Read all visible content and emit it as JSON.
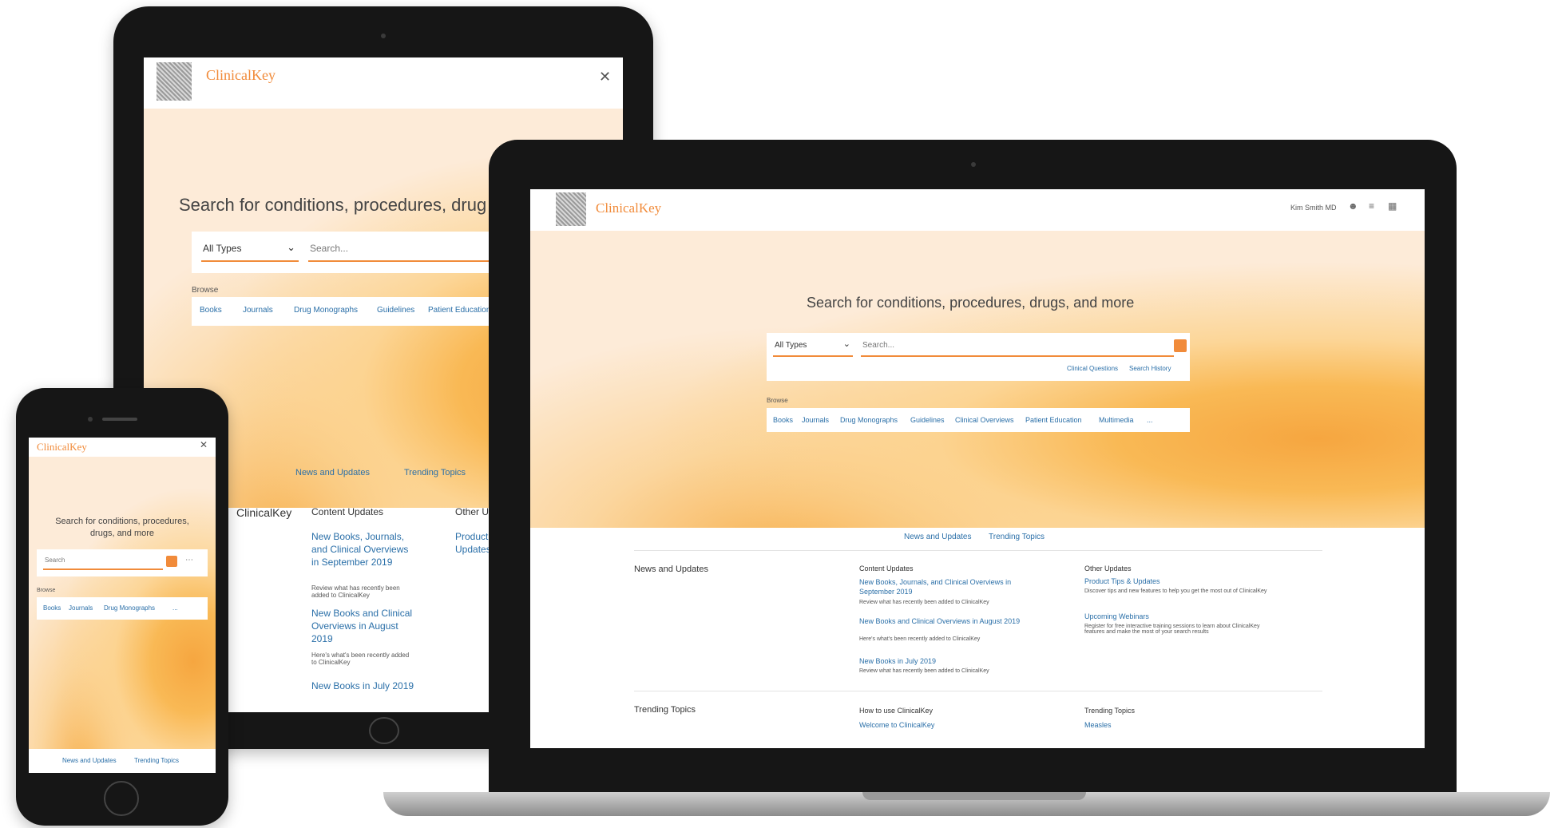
{
  "brand": {
    "name": "ClinicalKey"
  },
  "hero": {
    "headline": "Search for conditions, procedures, drugs, and more",
    "headline_tablet": "Search for conditions, procedures, drug",
    "headline_phone": "Search for conditions, procedures, drugs, and more"
  },
  "search": {
    "type_selected": "All Types",
    "placeholder": "Search...",
    "phone_placeholder": "Search",
    "links": [
      "Clinical Questions",
      "Search History"
    ]
  },
  "browse": {
    "label": "Browse",
    "items": [
      "Books",
      "Journals",
      "Drug Monographs",
      "Guidelines",
      "Clinical Overviews",
      "Patient Education",
      "Multimedia",
      "..."
    ],
    "tablet_items": [
      "Books",
      "Journals",
      "Drug Monographs",
      "Guidelines",
      "Patient Education"
    ],
    "phone_items": [
      "Books",
      "Journals",
      "Drug Monographs",
      "..."
    ]
  },
  "header_right": {
    "user": "Kim Smith MD",
    "icons": [
      "user-icon",
      "menu-icon",
      "grid-icon"
    ]
  },
  "tabs": [
    "News and Updates",
    "Trending Topics"
  ],
  "news": {
    "heading": "News and Updates",
    "tablet_heading": "ClinicalKey",
    "col1_title": "Content Updates",
    "col1_items": [
      {
        "title": "New Books, Journals, and Clinical Overviews in September 2019",
        "desc": "Review what has recently been added to ClinicalKey"
      },
      {
        "title": "New Books and Clinical Overviews in August 2019",
        "desc": "Here's what's been recently added to ClinicalKey"
      },
      {
        "title": "New Books in July 2019",
        "desc": "Review what has recently been added to ClinicalKey"
      }
    ],
    "col2_title": "Other Updates",
    "col2_items": [
      {
        "title": "Product Tips & Updates",
        "desc": "Discover tips and new features to help you get the most out of ClinicalKey"
      },
      {
        "title": "Upcoming Webinars",
        "desc": "Register for free interactive training sessions to learn about ClinicalKey features and make the most of your search results"
      }
    ]
  },
  "trending": {
    "heading": "Trending Topics",
    "col1_title": "How to use ClinicalKey",
    "col1_link": "Welcome to ClinicalKey",
    "col2_title": "Trending Topics",
    "col2_link": "Measles"
  },
  "colors": {
    "accent": "#f18b3a",
    "link": "#2a6fa8",
    "hero": "#fdebd8"
  }
}
